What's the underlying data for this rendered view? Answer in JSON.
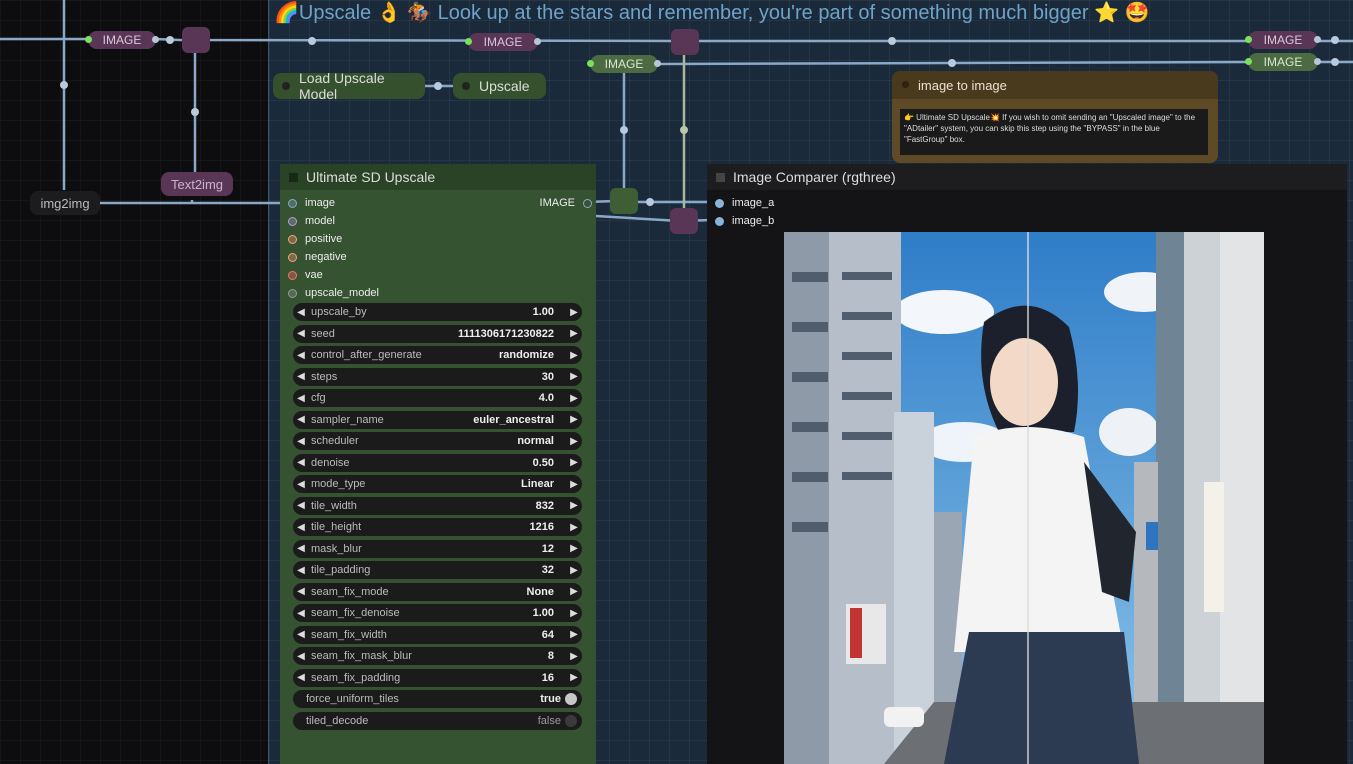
{
  "group": {
    "title": "🌈Upscale 👌 🏇 Look up at the stars and remember, you're part of something much bigger ⭐ 🤩"
  },
  "reroutes": {
    "image_1": "IMAGE",
    "image_2": "IMAGE",
    "image_3": "IMAGE",
    "image_4": "IMAGE",
    "image_5": "IMAGE"
  },
  "nodes": {
    "load_upscale_model": "Load Upscale Model",
    "upscale": "Upscale",
    "img2img": "img2img",
    "text2img": "Text2img"
  },
  "note": {
    "title": "image to image",
    "body": "👉 Ultimate SD Upscale💥   If you wish to omit sending an \"Upscaled image\" to the \"ADtailer\" system, you can skip this step using the \"BYPASS\" in the blue \"FastGroup\" box."
  },
  "usd": {
    "title": "Ultimate SD Upscale",
    "inputs": [
      {
        "label": "image",
        "color": "#8aa9cc"
      },
      {
        "label": "model",
        "color": "#b39ddb"
      },
      {
        "label": "positive",
        "color": "#ff9f7f"
      },
      {
        "label": "negative",
        "color": "#ff9f7f"
      },
      {
        "label": "vae",
        "color": "#ff6e6e"
      },
      {
        "label": "upscale_model",
        "color": "#999999"
      }
    ],
    "output": "IMAGE",
    "widgets": [
      {
        "name": "upscale_by",
        "value": "1.00"
      },
      {
        "name": "seed",
        "value": "1111306171230822"
      },
      {
        "name": "control_after_generate",
        "value": "randomize"
      },
      {
        "name": "steps",
        "value": "30"
      },
      {
        "name": "cfg",
        "value": "4.0"
      },
      {
        "name": "sampler_name",
        "value": "euler_ancestral"
      },
      {
        "name": "scheduler",
        "value": "normal"
      },
      {
        "name": "denoise",
        "value": "0.50"
      },
      {
        "name": "mode_type",
        "value": "Linear"
      },
      {
        "name": "tile_width",
        "value": "832"
      },
      {
        "name": "tile_height",
        "value": "1216"
      },
      {
        "name": "mask_blur",
        "value": "12"
      },
      {
        "name": "tile_padding",
        "value": "32"
      },
      {
        "name": "seam_fix_mode",
        "value": "None"
      },
      {
        "name": "seam_fix_denoise",
        "value": "1.00"
      },
      {
        "name": "seam_fix_width",
        "value": "64"
      },
      {
        "name": "seam_fix_mask_blur",
        "value": "8"
      },
      {
        "name": "seam_fix_padding",
        "value": "16"
      }
    ],
    "toggles": [
      {
        "name": "force_uniform_tiles",
        "value": "true",
        "on": true
      },
      {
        "name": "tiled_decode",
        "value": "false",
        "on": false
      }
    ]
  },
  "comparer": {
    "title": "Image Comparer (rgthree)",
    "inputs": [
      "image_a",
      "image_b"
    ]
  },
  "colors": {
    "wire": "#8aa9c8",
    "node_green": "#355231",
    "reroute_purple": "#5a3656"
  }
}
